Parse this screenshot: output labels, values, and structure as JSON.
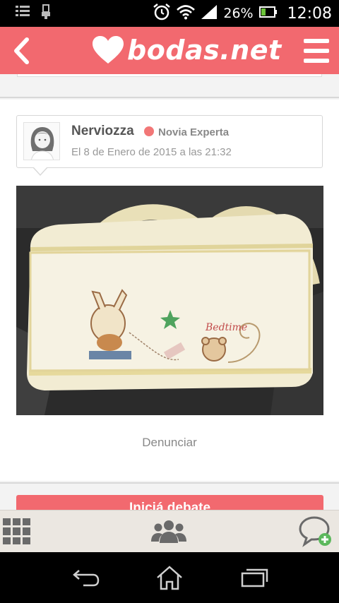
{
  "status_bar": {
    "battery_percent": "26%",
    "time": "12:08"
  },
  "header": {
    "logo_text": "bodas.net",
    "brand_color": "#f2696f"
  },
  "post": {
    "author_name": "Nerviozza",
    "author_rank": "Novia Experta",
    "date": "El 8 de Enero de 2015 a las 21:32",
    "report_label": "Denunciar"
  },
  "cta": {
    "label": "Iniciá debate"
  },
  "icons": {
    "back": "chevron-left-icon",
    "menu": "hamburger-icon",
    "grid": "grid-icon",
    "community": "group-icon",
    "new_chat": "chat-add-icon",
    "nav_back": "back-arrow-icon",
    "nav_home": "home-icon",
    "nav_recent": "recent-apps-icon"
  }
}
